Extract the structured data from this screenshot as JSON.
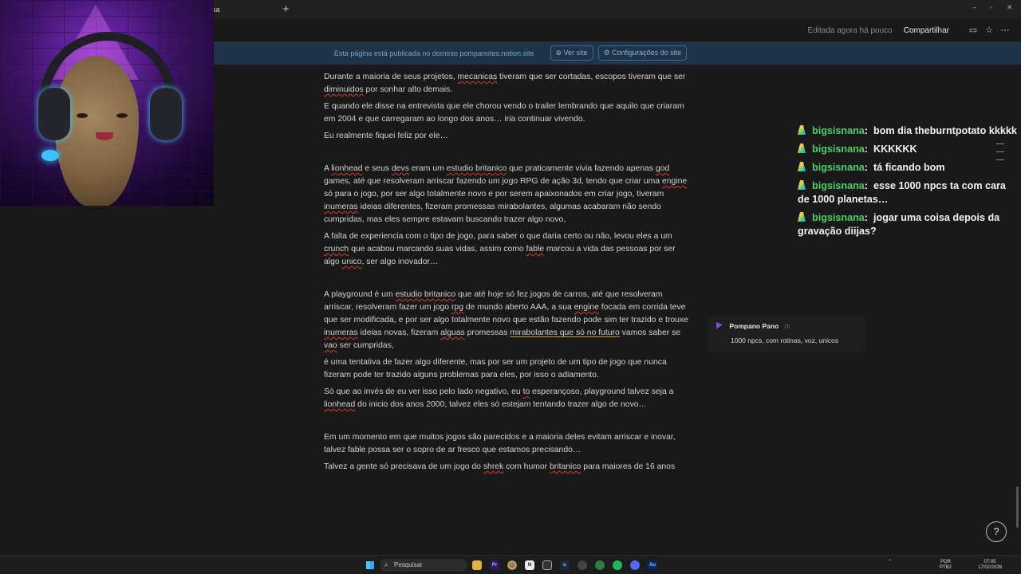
{
  "window": {
    "tab_title": "isa",
    "new_tab_label": "+",
    "minimize_label": "–",
    "maximize_label": "▫",
    "close_label": "✕"
  },
  "toolbar": {
    "edited_status": "Editada agora há pouco",
    "share_label": "Compartilhar"
  },
  "banner": {
    "message": "Esta página está publicada no domínio pompanotes.notion.site",
    "view_site_label": "⊕ Ver site",
    "site_settings_label": "⚙ Configurações do site"
  },
  "document": {
    "p1": [
      "Durante a maioria de seus projetos, ",
      "mecanicas",
      " tiveram que ser cortadas, escopos tiveram que ser ",
      "diminuidos",
      " por sonhar alto demais."
    ],
    "p2": "E quando ele disse na entrevista que ele chorou vendo o trailer lembrando que aquilo que criaram em 2004 e que carregaram ao longo dos anos… iria continuar vivendo.",
    "p3": "Eu realmente fiquei feliz por ele…",
    "p4": [
      "A ",
      "lionhead",
      " e seus ",
      "devs",
      " eram um ",
      "estudio britanico",
      " que praticamente vivia fazendo apenas ",
      "god",
      " games, até que resolveram arriscar fazendo um jogo RPG de ação 3d, tendo que criar uma ",
      "engine",
      " só para o jogo, por ser algo totalmente novo e por serem apaixonados em criar jogo, tiveram ",
      "inumeras",
      " ideias diferentes, fizeram promessas mirabolantes, algumas acabaram não sendo cumpridas, mas eles sempre estavam buscando trazer algo novo,"
    ],
    "p5": [
      "A falta de experiencia com o tipo de jogo, para saber o que daria certo ou não,  levou eles a um ",
      "crunch",
      " que acabou marcando suas vidas, assim como ",
      "fable",
      " marcou a vida das pessoas por ser algo ",
      "unico",
      ", ser algo inovador…"
    ],
    "p6": [
      "A playground é um ",
      "estudio britanico",
      " que até hoje só fez jogos de carros, até que resolveram arriscar, resolveram fazer um jogo ",
      "rpg",
      " de mundo aberto AAA, a sua ",
      "engine",
      " focada em corrida teve que ser modificada, e por ser algo totalmente novo que estão fazendo pode sim ter trazido e trouxe ",
      "inumeras",
      " ideias novas, fizeram ",
      "alguas",
      " promessas ",
      "mirabolantes que só no futuro",
      " vamos saber se ",
      "vao",
      " ser cumpridas,"
    ],
    "p7": "é uma tentativa de fazer algo diferente, mas por ser um projeto de um tipo de jogo que nunca fizeram pode ter trazido alguns problemas para eles, por isso o adiamento.",
    "p8": [
      "Só que ao invés de eu ver isso pelo lado negativo, eu ",
      "to",
      " esperançoso, playground talvez seja a ",
      "lionhead",
      " do inicio dos anos 2000,  talvez eles só estejam tentando trazer algo de novo…"
    ],
    "p9": "Em um momento em que muitos jogos são parecidos e a maioria deles evitam arriscar e inovar, talvez fable possa ser o sopro de ar fresco que estamos precisando…",
    "p10": [
      "Talvez a gente só precisava de um jogo do ",
      "shrek",
      " com humor ",
      "britanico",
      " para maiores de 16 anos"
    ]
  },
  "comment": {
    "author": "Pompano Pano",
    "time": "1h",
    "text": "1000 npcs, com rotinas, voz, unicos"
  },
  "chat": [
    {
      "user": "bigsisnana",
      "text": "bom dia theburntpotato kkkkk"
    },
    {
      "user": "bigsisnana",
      "text": "KKKKKK"
    },
    {
      "user": "bigsisnana",
      "text": "tá ficando bom"
    },
    {
      "user": "bigsisnana",
      "text": "esse 1000 npcs ta com cara de 1000 planetas…"
    },
    {
      "user": "bigsisnana",
      "text": "jogar uma coisa depois da gravação diijas?"
    }
  ],
  "fab_label": "?",
  "taskbar": {
    "search_placeholder": "Pesquisar",
    "lang": "POR",
    "layout": "PTB2",
    "time": "07:05",
    "date": "17/02/2026"
  },
  "colors": {
    "chat_username": "#47d06a",
    "banner_bg": "#1f3447",
    "background": "#191919"
  }
}
